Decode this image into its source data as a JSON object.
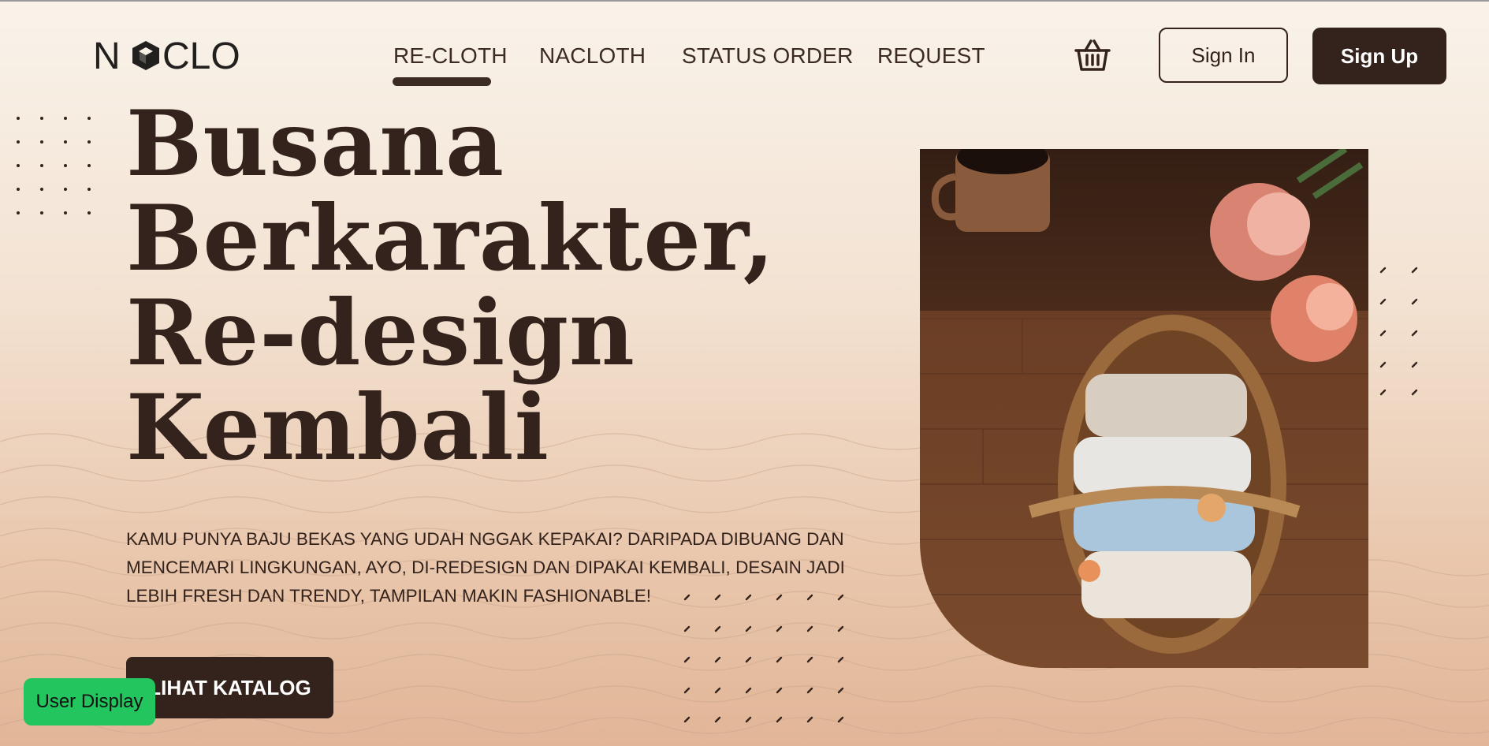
{
  "brand": {
    "logo_text": "NACLO"
  },
  "nav": {
    "items": [
      {
        "label": "RE-CLOTH",
        "active": true
      },
      {
        "label": "NACLOTH",
        "active": false
      },
      {
        "label": "STATUS ORDER",
        "active": false
      },
      {
        "label": "REQUEST",
        "active": false
      }
    ]
  },
  "header": {
    "cart_icon": "basket-icon",
    "signin_label": "Sign In",
    "signup_label": "Sign Up"
  },
  "hero": {
    "headline_lines": [
      "Busana",
      "Berkarakter,",
      "Re-design",
      "Kembali"
    ],
    "description": "Kamu punya baju bekas yang udah nggak kepakai? daripada dibuang dan mencemari lingkungan, ayo, di-redesign dan dipakai kembali, desain jadi lebih fresh dan trendy, tampilan makin fashionable!",
    "cta_label": "LIHAT KATALOG",
    "image_alt": "basket-of-folded-sweaters-photo"
  },
  "overlay": {
    "user_display_label": "User Display"
  },
  "colors": {
    "dark_brown": "#33231c",
    "bg_top": "#f9f3ea",
    "bg_bottom": "#e2b597",
    "user_display_green": "#22c55e"
  }
}
